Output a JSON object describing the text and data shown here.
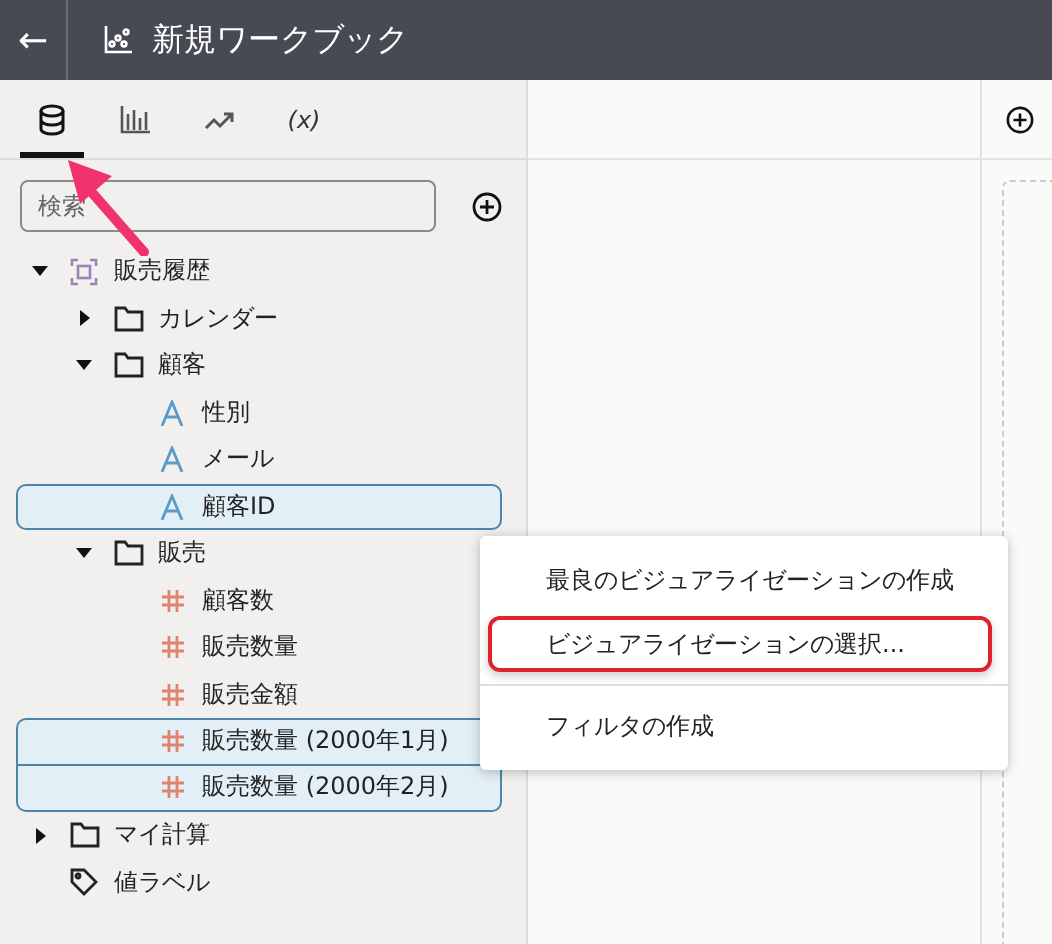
{
  "header": {
    "back": "←",
    "title": "新規ワークブック"
  },
  "tabs": [
    {
      "kind": "database",
      "selected": true
    },
    {
      "kind": "chart",
      "selected": false
    },
    {
      "kind": "trend",
      "selected": false
    },
    {
      "kind": "text",
      "label": "(x)",
      "selected": false
    }
  ],
  "search": {
    "placeholder": "検索"
  },
  "tree": [
    {
      "kind": "dataset",
      "label": "販売履歴",
      "expanded": true,
      "selected": false,
      "children": [
        {
          "kind": "folder",
          "label": "カレンダー",
          "expanded": false,
          "selected": false
        },
        {
          "kind": "folder",
          "label": "顧客",
          "expanded": true,
          "selected": false,
          "children": [
            {
              "kind": "attribute",
              "label": "性別",
              "selected": false
            },
            {
              "kind": "attribute",
              "label": "メール",
              "selected": false
            },
            {
              "kind": "attribute",
              "label": "顧客ID",
              "selected": true
            }
          ]
        },
        {
          "kind": "folder",
          "label": "販売",
          "expanded": true,
          "selected": false,
          "children": [
            {
              "kind": "measure",
              "label": "顧客数",
              "selected": false
            },
            {
              "kind": "measure",
              "label": "販売数量",
              "selected": false
            },
            {
              "kind": "measure",
              "label": "販売金額",
              "selected": false
            },
            {
              "kind": "measure",
              "label": "販売数量 (2000年1月)",
              "selected": true
            },
            {
              "kind": "measure",
              "label": "販売数量 (2000年2月)",
              "selected": true
            }
          ]
        }
      ]
    },
    {
      "kind": "folder",
      "label": "マイ計算",
      "expanded": false,
      "selected": false
    },
    {
      "kind": "tag",
      "label": "値ラベル",
      "selected": false
    }
  ],
  "context_menu": [
    {
      "label": "最良のビジュアライゼーションの作成",
      "highlighted": false,
      "divider_before": false
    },
    {
      "label": "ビジュアライゼーションの選択...",
      "highlighted": true,
      "divider_before": false
    },
    {
      "label": "フィルタの作成",
      "highlighted": false,
      "divider_before": true
    }
  ]
}
